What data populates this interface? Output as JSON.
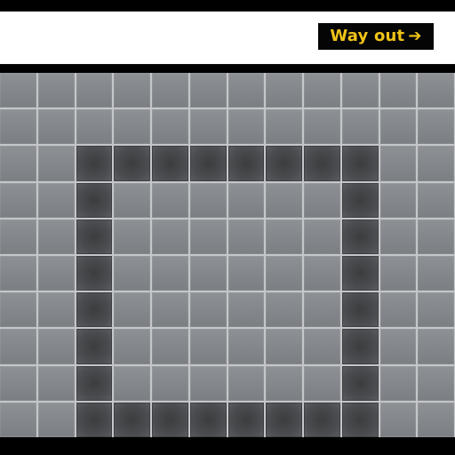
{
  "sign": {
    "text": "Way out",
    "arrow_icon": "right-arrow-icon",
    "text_color": "#f0c318",
    "background_color": "#050505"
  },
  "wall": {
    "tile_color": "#83878b",
    "accent_tile_color": "#4b4d50",
    "grout_color": "#c4c6c9"
  }
}
